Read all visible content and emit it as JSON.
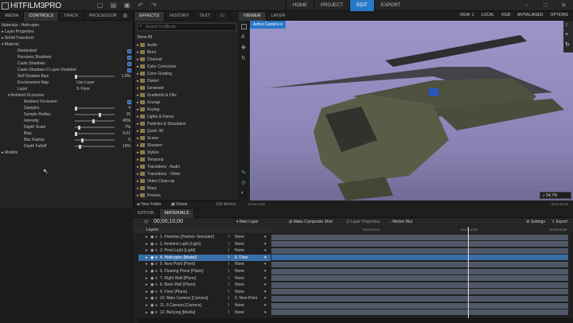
{
  "app": {
    "title": "HITFILM3PRO"
  },
  "main_tabs": [
    {
      "label": "HOME"
    },
    {
      "label": "PROJECT"
    },
    {
      "label": "EDIT"
    },
    {
      "label": "EXPORT"
    }
  ],
  "left_panel": {
    "tabs": [
      {
        "label": "MEDIA"
      },
      {
        "label": "CONTROLS"
      },
      {
        "label": "TRACK"
      },
      {
        "label": "PROCESSOR"
      }
    ],
    "breadcrumb": "Materials › Helicopter",
    "rows": [
      {
        "label": "Layer Properties"
      },
      {
        "label": "World Transform"
      },
      {
        "label": "Material"
      },
      {
        "label": "Illuminated",
        "check": true
      },
      {
        "label": "Receives Shadows",
        "check": true
      },
      {
        "label": "Casts Shadows",
        "check": true
      },
      {
        "label": "Casts Shadows If Layer Disabled",
        "check": true
      },
      {
        "label": "Self Shadow Bias",
        "value": "1.0%"
      },
      {
        "label": "Environment Map",
        "value": "Use Layer"
      },
      {
        "label": "Layer",
        "value": "9. Floor"
      },
      {
        "label": "Ambient Occlusion"
      },
      {
        "label": "Ambient Occlusion",
        "check": true
      },
      {
        "label": "Samples",
        "value": "4"
      },
      {
        "label": "Sample Radius",
        "value": "15"
      },
      {
        "label": "Intensity",
        "value": "45%"
      },
      {
        "label": "Depth Scale",
        "value": "7%"
      },
      {
        "label": "Bias",
        "value": "0.01"
      },
      {
        "label": "Blur Radius",
        "value": "5"
      },
      {
        "label": "Depth Falloff",
        "value": "10%"
      },
      {
        "label": "Models"
      }
    ]
  },
  "effects_panel": {
    "tabs": [
      {
        "label": "EFFECTS"
      },
      {
        "label": "HISTORY"
      },
      {
        "label": "TEXT"
      },
      {
        "label": "LI"
      }
    ],
    "search_placeholder": "Search in Effects",
    "show_all": "Show All",
    "items": [
      "Audio",
      "Blurs",
      "Channel",
      "Color Correction",
      "Color Grading",
      "Distort",
      "Generate",
      "Gradients & Fills",
      "Grunge",
      "Keying",
      "Lights & Flares",
      "Particles & Simulation",
      "Quick 3D",
      "Scene",
      "Sharpen",
      "Stylize",
      "Temporal",
      "Transitions - Audio",
      "Transitions - Video",
      "Video Clean-up",
      "Warp",
      "Presets"
    ],
    "new_folder": "New Folder",
    "delete": "Delete",
    "count": "316 item(s)"
  },
  "viewer": {
    "tabs": [
      {
        "label": "VIEWER"
      },
      {
        "label": "LAYER"
      }
    ],
    "toolbar": {
      "view": "VIEW: 1",
      "local": "LOCAL",
      "rgb": "RGB",
      "aa": "ANTIALIASED",
      "options": "OPTIONS"
    },
    "camera": "Active Camera",
    "zoom": "54.7%",
    "time_start": "00;00;10;00",
    "time_end": "00;01;00;00"
  },
  "timeline": {
    "tabs": [
      {
        "label": "EDITOR"
      },
      {
        "label": "MATERIALS"
      }
    ],
    "timecode": "00;00;10;00",
    "buttons": {
      "new_layer": "New Layer",
      "composite": "Make Composite Shot",
      "layer_props": "Layer Properties",
      "motion_blur": "Motion Blur",
      "settings": "Settings",
      "export": "Export"
    },
    "layers_header": "Layers",
    "ruler": [
      "00;00;05;00",
      "00;00;10;00",
      "00;00;15;00"
    ],
    "layers": [
      {
        "name": "1. Particles [Particle Simulator]",
        "parent": "None"
      },
      {
        "name": "2. Ambient Light [Light]",
        "parent": "None"
      },
      {
        "name": "3. Point Light [Light]",
        "parent": "None"
      },
      {
        "name": "4. Helicopter [Model]",
        "parent": "9. Floor",
        "selected": true
      },
      {
        "name": "5. New Point [Point]",
        "parent": "None"
      },
      {
        "name": "6. Floating Plane [Plane]",
        "parent": "None"
      },
      {
        "name": "7. Right Wall [Plane]",
        "parent": "None"
      },
      {
        "name": "8. Back Wall [Plane]",
        "parent": "None"
      },
      {
        "name": "9. Floor [Plane]",
        "parent": "None"
      },
      {
        "name": "10. Main Camera [Camera]",
        "parent": "5. New Point"
      },
      {
        "name": "11. 8 Camera [Camera]",
        "parent": "None"
      },
      {
        "name": "12. Ball.png [Media]",
        "parent": "None"
      }
    ]
  }
}
